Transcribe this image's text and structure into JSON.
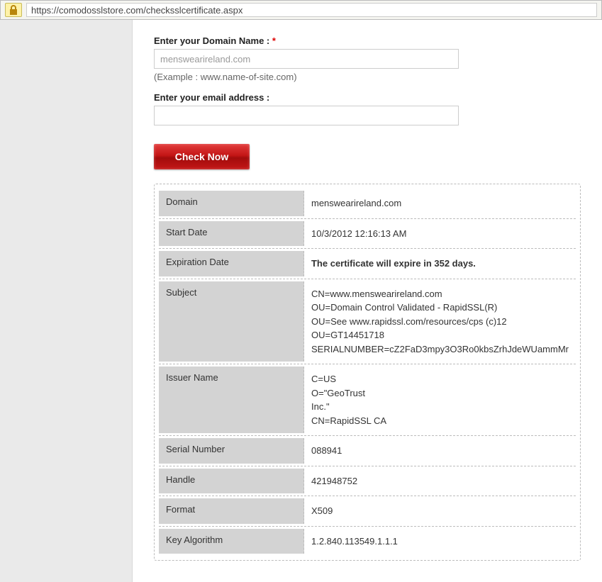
{
  "browser": {
    "url": "https://comodosslstore.com/checksslcertificate.aspx"
  },
  "form": {
    "domain_label": "Enter your Domain Name :",
    "required_mark": "*",
    "domain_placeholder": "menswearireland.com",
    "example_text": "(Example : www.name-of-site.com)",
    "email_label": "Enter your email address :",
    "email_value": "",
    "check_button": "Check Now"
  },
  "results": {
    "rows": [
      {
        "label": "Domain",
        "value": "menswearireland.com"
      },
      {
        "label": "Start Date",
        "value": "10/3/2012 12:16:13 AM"
      },
      {
        "label": "Expiration Date",
        "value": "The certificate will expire in 352 days.",
        "bold": true
      },
      {
        "label": "Subject",
        "lines": [
          "CN=www.menswearireland.com",
          "OU=Domain Control Validated - RapidSSL(R)",
          "OU=See www.rapidssl.com/resources/cps (c)12",
          "OU=GT14451718",
          "SERIALNUMBER=cZ2FaD3mpy3O3Ro0kbsZrhJdeWUammMr"
        ]
      },
      {
        "label": "Issuer Name",
        "lines": [
          "C=US",
          "O=\"GeoTrust",
          "Inc.\"",
          "CN=RapidSSL CA"
        ]
      },
      {
        "label": "Serial Number",
        "value": "088941"
      },
      {
        "label": "Handle",
        "value": "421948752"
      },
      {
        "label": "Format",
        "value": "X509"
      },
      {
        "label": "Key Algorithm",
        "value": "1.2.840.113549.1.1.1"
      }
    ]
  }
}
